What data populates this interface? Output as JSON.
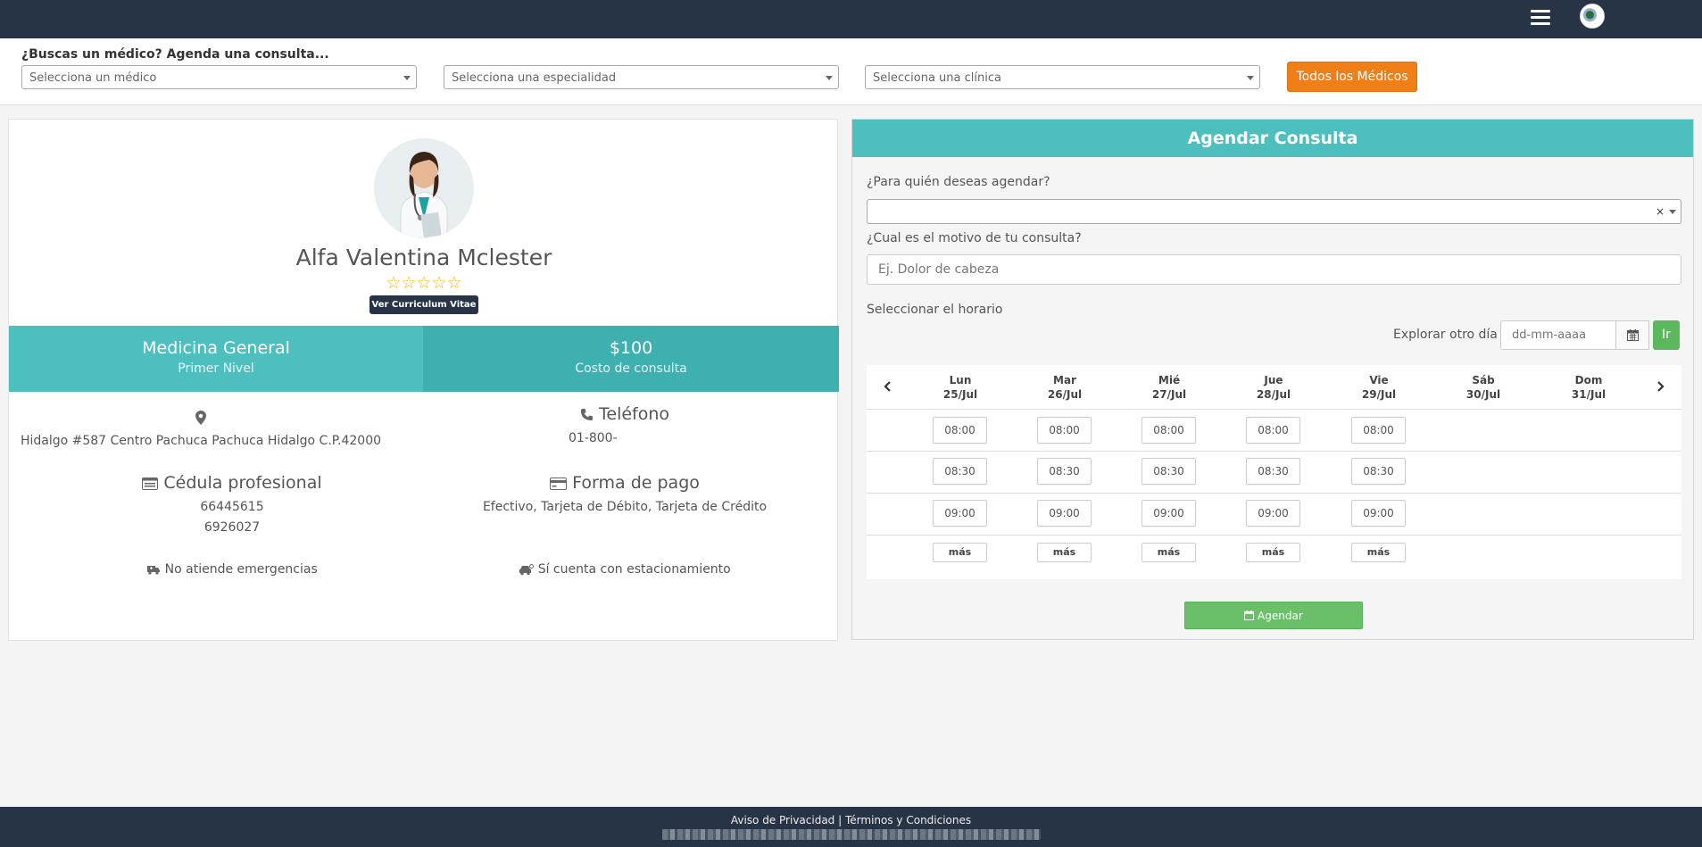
{
  "search": {
    "title": "¿Buscas un médico? Agenda una consulta...",
    "doctor_placeholder": "Selecciona un médico",
    "specialty_placeholder": "Selecciona una especialidad",
    "clinic_placeholder": "Selecciona una clínica",
    "all_doctors_button": "Todos los Médicos"
  },
  "profile": {
    "name": "Alfa Valentina Mclester",
    "stars": "☆☆☆☆☆",
    "rating": 0,
    "cv_button": "Ver Curriculum Vitae",
    "specialty": "Medicina General",
    "level": "Primer Nivel",
    "price": "$100",
    "price_label": "Costo de consulta",
    "address": "Hidalgo #587 Centro Pachuca Pachuca Hidalgo C.P.42000",
    "phone_title": "Teléfono",
    "phone": "01-800-",
    "license_title": "Cédula profesional",
    "licenses": [
      "66445615",
      "6926027"
    ],
    "payment_title": "Forma de pago",
    "payment_methods": "Efectivo, Tarjeta de Débito, Tarjeta de Crédito",
    "emergencies": "No atiende emergencias",
    "parking": "Sí cuenta con estacionamiento"
  },
  "appointment": {
    "title": "Agendar Consulta",
    "for_whom_label": "¿Para quién deseas agendar?",
    "reason_label": "¿Cual es el motivo de tu consulta?",
    "reason_placeholder": "Ej. Dolor de cabeza",
    "schedule_label": "Seleccionar el horario",
    "explore_label": "Explorar otro día",
    "date_placeholder": "dd-mm-aaaa",
    "go_button": "Ir",
    "days": [
      {
        "name": "Lun",
        "date": "25/Jul"
      },
      {
        "name": "Mar",
        "date": "26/Jul"
      },
      {
        "name": "Mié",
        "date": "27/Jul"
      },
      {
        "name": "Jue",
        "date": "28/Jul"
      },
      {
        "name": "Vie",
        "date": "29/Jul"
      },
      {
        "name": "Sáb",
        "date": "30/Jul"
      },
      {
        "name": "Dom",
        "date": "31/Jul"
      }
    ],
    "times": [
      "08:00",
      "08:30",
      "09:00"
    ],
    "more_label": "más",
    "submit_button": "Agendar"
  },
  "footer": {
    "privacy": "Aviso de Privacidad",
    "separator": "|",
    "terms": "Términos y Condiciones"
  },
  "colors": {
    "topbar": "#263445",
    "accent_teal": "#4ebfbf",
    "orange_button": "#f07f17",
    "green_button": "#5cb85c",
    "star_gold": "#f5b400"
  }
}
